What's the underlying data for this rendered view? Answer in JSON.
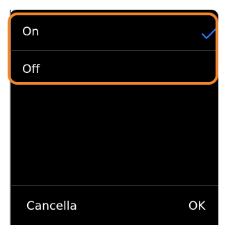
{
  "options": [
    {
      "label": "On",
      "selected": true
    },
    {
      "label": "Off",
      "selected": false
    }
  ],
  "buttons": {
    "cancel_label": "Cancella",
    "ok_label": "OK"
  },
  "colors": {
    "background": "#000000",
    "text": "#ffffff",
    "check": "#2979ff",
    "highlight": "#f2842a"
  },
  "icons": {
    "selected": "checkmark-icon"
  }
}
